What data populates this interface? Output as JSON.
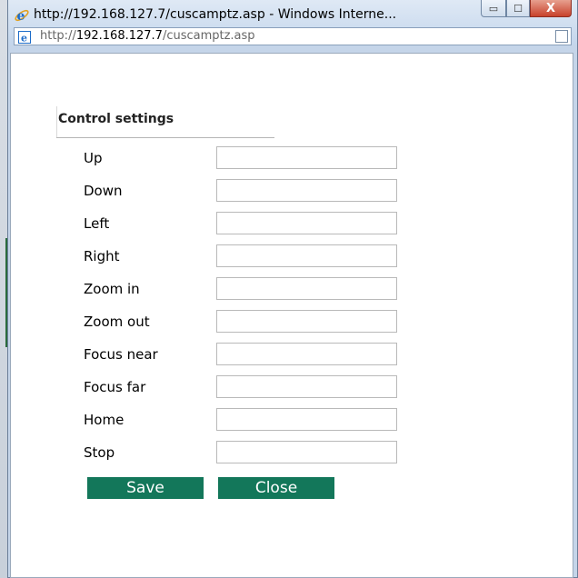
{
  "window": {
    "title": "http://192.168.127.7/cuscamptz.asp - Windows Interne...",
    "buttons": {
      "minimize": "▭",
      "maximize": "☐",
      "close": "X"
    }
  },
  "address": {
    "prefix": "http://",
    "host": "192.168.127.7",
    "path": "/cuscamptz.asp"
  },
  "settings": {
    "title": "Control settings",
    "fields": [
      {
        "label": "Up",
        "value": ""
      },
      {
        "label": "Down",
        "value": ""
      },
      {
        "label": "Left",
        "value": ""
      },
      {
        "label": "Right",
        "value": ""
      },
      {
        "label": "Zoom in",
        "value": ""
      },
      {
        "label": "Zoom out",
        "value": ""
      },
      {
        "label": "Focus near",
        "value": ""
      },
      {
        "label": "Focus far",
        "value": ""
      },
      {
        "label": "Home",
        "value": ""
      },
      {
        "label": "Stop",
        "value": ""
      }
    ],
    "save_label": "Save",
    "close_label": "Close"
  },
  "colors": {
    "button_bg": "#13775a",
    "title_bar": "#c4d6ec"
  },
  "icons": {
    "browser": "internet-explorer-icon",
    "page": "page-icon",
    "compat": "compatibility-view-icon"
  }
}
